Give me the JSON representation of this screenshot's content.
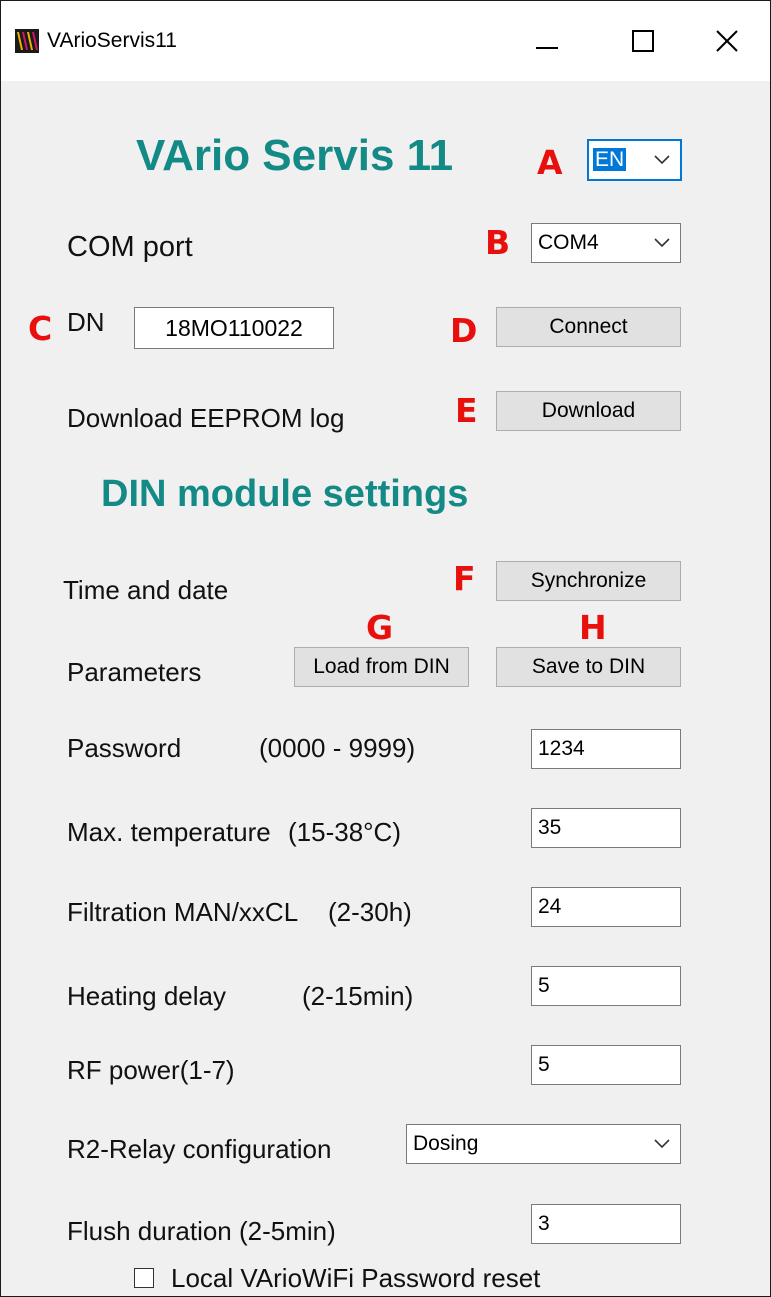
{
  "window": {
    "title": "VArioServis11"
  },
  "app": {
    "heading": "VArio Servis 11"
  },
  "language": {
    "selected": "EN"
  },
  "markers": {
    "a": "A",
    "b": "B",
    "c": "C",
    "d": "D",
    "e": "E",
    "f": "F",
    "g": "G",
    "h": "H"
  },
  "com": {
    "label": "COM port",
    "selected": "COM4"
  },
  "dn": {
    "label": "DN",
    "value": "18MO110022"
  },
  "connect": {
    "label": "Connect"
  },
  "eeprom": {
    "label": "Download EEPROM log",
    "button": "Download"
  },
  "din": {
    "heading": "DIN module settings",
    "time_label": "Time and date",
    "sync_button": "Synchronize",
    "params_label": "Parameters",
    "load_button": "Load from DIN",
    "save_button": "Save to DIN"
  },
  "fields": {
    "password": {
      "label": "Password",
      "range": "(0000 - 9999)",
      "value": "1234"
    },
    "max_temp": {
      "label": "Max. temperature",
      "range": "(15-38°C)",
      "value": "35"
    },
    "filtration": {
      "label": "Filtration MAN/xxCL",
      "range": "(2-30h)",
      "value": "24"
    },
    "heating": {
      "label": "Heating delay",
      "range": "(2-15min)",
      "value": "5"
    },
    "rf_power": {
      "label": "RF power(1-7)",
      "value": "5"
    },
    "relay": {
      "label": "R2-Relay configuration",
      "selected": "Dosing"
    },
    "flush": {
      "label": "Flush duration (2-5min)",
      "value": "3"
    }
  },
  "wifi_reset": {
    "label": "Local VArioWiFi Password reset",
    "checked": false
  },
  "colors": {
    "heading": "#148a86",
    "marker": "#e8100c",
    "focus": "#0078d7"
  },
  "icons": {
    "app": "app-logo-icon",
    "minimize": "minimize-icon",
    "maximize": "maximize-icon",
    "close": "close-icon",
    "dropdown": "chevron-down-icon"
  }
}
